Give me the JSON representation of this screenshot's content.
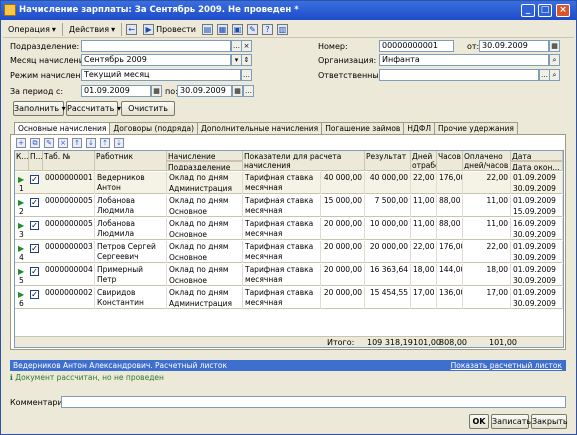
{
  "window": {
    "title": "Начисление зарплаты: За Сентябрь 2009. Не проведен *",
    "min": "_",
    "max": "□",
    "close": "×"
  },
  "toolbar": {
    "operation": "Операция",
    "actions": "Действия",
    "post": "Провести",
    "help": "?"
  },
  "form": {
    "department_label": "Подразделение:",
    "department_value": "",
    "month_label": "Месяц начисления:",
    "month_value": "Сентябрь 2009",
    "mode_label": "Режим начисления:",
    "mode_value": "Текущий месяц",
    "period_label": "За период с:",
    "period_from": "01.09.2009",
    "period_to_label": "по:",
    "period_to": "30.09.2009",
    "number_label": "Номер:",
    "number_value": "00000000001",
    "date_label": "от:",
    "date_value": "30.09.2009",
    "org_label": "Организация:",
    "org_value": "Инфанта",
    "resp_label": "Ответственный:",
    "resp_value": ""
  },
  "buttons": {
    "fill": "Заполнить",
    "calc": "Рассчитать",
    "clear": "Очистить"
  },
  "tabs": [
    "Основные начисления",
    "Договоры (подряда)",
    "Дополнительные начисления",
    "Погашение займов",
    "НДФЛ",
    "Прочие удержания"
  ],
  "grid": {
    "headers": {
      "k": "К...",
      "p": "П...",
      "n": "N",
      "tab": "Таб. №",
      "worker": "Работник",
      "accrual": "Начисление",
      "dept": "Подразделение",
      "indicators": "Показатели для расчета начисления",
      "result": "Результат",
      "days": "Дней отработано",
      "hours": "Часов",
      "paid": "Оплачено дней/часов",
      "start": "Дата начала",
      "end": "Дата окон..."
    },
    "rows": [
      {
        "n": "1",
        "tab": "0000000001",
        "worker": "Ведерников Антон Александрович",
        "accrual": "Оклад по дням",
        "dept": "Администрация",
        "ind_name": "Тарифная ставка месячная",
        "ind_val": "40 000,00",
        "result": "40 000,00",
        "days": "22,00",
        "hours": "176,00",
        "paid": "22,00",
        "start": "01.09.2009",
        "end": "30.09.2009"
      },
      {
        "n": "2",
        "tab": "0000000005",
        "worker": "Лобанова Людмила Алексеевна",
        "accrual": "Оклад по дням",
        "dept": "Основное",
        "ind_name": "Тарифная ставка месячная",
        "ind_val": "15 000,00",
        "result": "7 500,00",
        "days": "11,00",
        "hours": "88,00",
        "paid": "11,00",
        "start": "01.09.2009",
        "end": "15.09.2009"
      },
      {
        "n": "3",
        "tab": "0000000005",
        "worker": "Лобанова Людмила Алексеевна",
        "accrual": "Оклад по дням",
        "dept": "Основное",
        "ind_name": "Тарифная ставка месячная",
        "ind_val": "20 000,00",
        "result": "10 000,00",
        "days": "11,00",
        "hours": "88,00",
        "paid": "11,00",
        "start": "16.09.2009",
        "end": "30.09.2009"
      },
      {
        "n": "4",
        "tab": "0000000003",
        "worker": "Петров Сергей Сергеевич",
        "accrual": "Оклад по дням",
        "dept": "Основное",
        "ind_name": "Тарифная ставка месячная",
        "ind_val": "20 000,00",
        "result": "20 000,00",
        "days": "22,00",
        "hours": "176,00",
        "paid": "22,00",
        "start": "01.09.2009",
        "end": "30.09.2009"
      },
      {
        "n": "5",
        "tab": "0000000004",
        "worker": "Примерный Петр Нестерович",
        "accrual": "Оклад по дням",
        "dept": "Основное",
        "ind_name": "Тарифная ставка месячная",
        "ind_val": "20 000,00",
        "result": "16 363,64",
        "days": "18,00",
        "hours": "144,00",
        "paid": "18,00",
        "start": "01.09.2009",
        "end": "30.09.2009"
      },
      {
        "n": "6",
        "tab": "0000000002",
        "worker": "Свиридов Константин",
        "accrual": "Оклад по дням",
        "dept": "Администрация",
        "ind_name": "Тарифная ставка месячная",
        "ind_val": "20 000,00",
        "result": "15 454,55",
        "days": "17,00",
        "hours": "136,00",
        "paid": "17,00",
        "start": "01.09.2009",
        "end": "30.09.2009"
      }
    ],
    "total_label": "Итого:",
    "total_result": "109 318,19",
    "total_days": "101,00",
    "total_hours": "808,00",
    "total_paid": "101,00"
  },
  "bottom": {
    "caption": "Ведерников Антон Александрович. Расчетный листок",
    "show_link": "Показать расчетный листок"
  },
  "status": "Документ рассчитан, но не проведен",
  "comment_label": "Комментарий:",
  "footer_buttons": {
    "ok": "OK",
    "save": "Записать",
    "close": "Закрыть"
  }
}
